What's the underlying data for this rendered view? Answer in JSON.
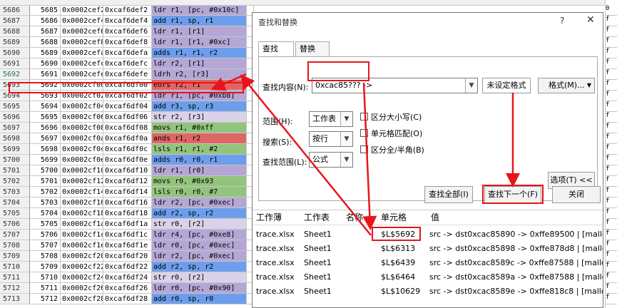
{
  "sheet_rows": [
    {
      "rn": "5686",
      "a": "5685",
      "b": "0x0002cef2",
      "c": "0xcaf6def2",
      "d": "ldr r1, [pc, #0x10c]",
      "color": "purple"
    },
    {
      "rn": "5687",
      "a": "5686",
      "b": "0x0002cef4",
      "c": "0xcaf6def4",
      "d": "add r1, sp, r1",
      "color": "blue"
    },
    {
      "rn": "5688",
      "a": "5687",
      "b": "0x0002cef6",
      "c": "0xcaf6def6",
      "d": "ldr r1, [r1]",
      "color": "purple"
    },
    {
      "rn": "5689",
      "a": "5688",
      "b": "0x0002cef8",
      "c": "0xcaf6def8",
      "d": "ldr r1, [r1, #0xc]",
      "color": "purple"
    },
    {
      "rn": "5690",
      "a": "5689",
      "b": "0x0002cefa",
      "c": "0xcaf6defa",
      "d": "adds r1, r1, r2",
      "color": "blue"
    },
    {
      "rn": "5691",
      "a": "5690",
      "b": "0x0002cefc",
      "c": "0xcaf6defc",
      "d": "ldr r2, [r1]",
      "color": "purple"
    },
    {
      "rn": "5692",
      "a": "5691",
      "b": "0x0002cefe",
      "c": "0xcaf6defe",
      "d": "ldrh r2, [r3]",
      "color": "purple",
      "sel": true
    },
    {
      "rn": "5693",
      "a": "5692",
      "b": "0x0002cf00",
      "c": "0xcaf6df00",
      "d": "eors r2, r1",
      "color": "red"
    },
    {
      "rn": "5694",
      "a": "5693",
      "b": "0x0002cf02",
      "c": "0xcaf6df02",
      "d": "ldr r1, [pc, #0xb8]",
      "color": "purple"
    },
    {
      "rn": "5695",
      "a": "5694",
      "b": "0x0002cf04",
      "c": "0xcaf6df04",
      "d": "add r3, sp, r3",
      "color": "blue"
    },
    {
      "rn": "5696",
      "a": "5695",
      "b": "0x0002cf06",
      "c": "0xcaf6df06",
      "d": "str r2, [r3]",
      "color": "lpurple"
    },
    {
      "rn": "5697",
      "a": "5696",
      "b": "0x0002cf08",
      "c": "0xcaf6df08",
      "d": "movs r1, #0xff",
      "color": "green"
    },
    {
      "rn": "5698",
      "a": "5697",
      "b": "0x0002cf0a",
      "c": "0xcaf6df0a",
      "d": "ands r1, r2",
      "color": "red"
    },
    {
      "rn": "5699",
      "a": "5698",
      "b": "0x0002cf0c",
      "c": "0xcaf6df0c",
      "d": "lsls r1, r1, #2",
      "color": "green"
    },
    {
      "rn": "5700",
      "a": "5699",
      "b": "0x0002cf0e",
      "c": "0xcaf6df0e",
      "d": "adds r0, r0, r1",
      "color": "blue"
    },
    {
      "rn": "5701",
      "a": "5700",
      "b": "0x0002cf10",
      "c": "0xcaf6df10",
      "d": "ldr r1, [r0]",
      "color": "purple"
    },
    {
      "rn": "5702",
      "a": "5701",
      "b": "0x0002cf12",
      "c": "0xcaf6df12",
      "d": "movs r0, #0x93",
      "color": "green"
    },
    {
      "rn": "5703",
      "a": "5702",
      "b": "0x0002cf14",
      "c": "0xcaf6df14",
      "d": "lsls r0, r0, #7",
      "color": "green"
    },
    {
      "rn": "5704",
      "a": "5703",
      "b": "0x0002cf16",
      "c": "0xcaf6df16",
      "d": "ldr r2, [pc, #0xec]",
      "color": "purple"
    },
    {
      "rn": "5705",
      "a": "5704",
      "b": "0x0002cf18",
      "c": "0xcaf6df18",
      "d": "add r2, sp, r2",
      "color": "blue"
    },
    {
      "rn": "5706",
      "a": "5705",
      "b": "0x0002cf1a",
      "c": "0xcaf6df1a",
      "d": "str r0, [r2]",
      "color": "lpurple"
    },
    {
      "rn": "5707",
      "a": "5706",
      "b": "0x0002cf1c",
      "c": "0xcaf6df1c",
      "d": "ldr r4, [pc, #0xe8]",
      "color": "purple"
    },
    {
      "rn": "5708",
      "a": "5707",
      "b": "0x0002cf1e",
      "c": "0xcaf6df1e",
      "d": "ldr r0, [pc, #0xec]",
      "color": "purple"
    },
    {
      "rn": "5709",
      "a": "5708",
      "b": "0x0002cf20",
      "c": "0xcaf6df20",
      "d": "ldr r2, [pc, #0xec]",
      "color": "purple"
    },
    {
      "rn": "5710",
      "a": "5709",
      "b": "0x0002cf22",
      "c": "0xcaf6df22",
      "d": "add r2, sp, r2",
      "color": "blue"
    },
    {
      "rn": "5711",
      "a": "5710",
      "b": "0x0002cf24",
      "c": "0xcaf6df24",
      "d": "str r0, [r2]",
      "color": "lpurple"
    },
    {
      "rn": "5712",
      "a": "5711",
      "b": "0x0002cf26",
      "c": "0xcaf6df26",
      "d": "ldr r0, [pc, #0x90]",
      "color": "purple"
    },
    {
      "rn": "5713",
      "a": "5712",
      "b": "0x0002cf28",
      "c": "0xcaf6df28",
      "d": "add r0, sp, r0",
      "color": "blue"
    }
  ],
  "dialog": {
    "title": "查找和替换",
    "help": "?",
    "close": "✕",
    "tabs": [
      {
        "label": "查找(D)",
        "active": true
      },
      {
        "label": "替换(P)",
        "active": false
      }
    ],
    "find_label": "查找内容(N):",
    "find_value": "0xcac85??? ->",
    "format_status": "未设定格式",
    "format_button": "格式(M)...",
    "scope_label": "范围(H):",
    "scope_value": "工作表",
    "search_label": "搜索(S):",
    "search_value": "按行",
    "lookin_label": "查找范围(L):",
    "lookin_value": "公式",
    "match_case": "区分大小写(C)",
    "match_cell": "单元格匹配(O)",
    "match_width": "区分全/半角(B)",
    "options_button": "选项(T) <<",
    "find_all": "查找全部(I)",
    "find_next": "查找下一个(F)",
    "close_button": "关闭"
  },
  "results": {
    "headers": [
      "工作薄",
      "工作表",
      "名称",
      "单元格",
      "值"
    ],
    "rows": [
      {
        "book": "trace.xlsx",
        "sheet": "Sheet1",
        "name": "",
        "cell": "$L$5692",
        "value": "src -> dst0xcac85890 -> 0xffe89500  |  [mallo"
      },
      {
        "book": "trace.xlsx",
        "sheet": "Sheet1",
        "name": "",
        "cell": "$L$6313",
        "value": "src -> dst0xcac85898 -> 0xffe878d8  |  [mallo"
      },
      {
        "book": "trace.xlsx",
        "sheet": "Sheet1",
        "name": "",
        "cell": "$L$6439",
        "value": "src -> dst0xcac8589c -> 0xffe87588  |  [mallo"
      },
      {
        "book": "trace.xlsx",
        "sheet": "Sheet1",
        "name": "",
        "cell": "$L$6464",
        "value": "src -> dst0xcac8589a -> 0xffe87588  |  [mallo"
      },
      {
        "book": "trace.xlsx",
        "sheet": "Sheet1",
        "name": "",
        "cell": "$L$10629",
        "value": "src -> dst0xcac8589e -> 0xffe818c8  |  [mallo"
      }
    ]
  },
  "right_cells": [
    "0",
    "f",
    "f",
    "f",
    "f",
    "f",
    "f",
    "f",
    "f",
    "f",
    "f",
    "f",
    "f",
    "f",
    "f",
    "f",
    "f",
    "f",
    "f",
    "f",
    "f",
    "f",
    "f",
    "f",
    "f",
    "f",
    "f",
    "f"
  ],
  "colors": {
    "purple": "#b4a7d6",
    "blue": "#6d9eeb",
    "green": "#93c47d",
    "red": "#e06666",
    "lpurple": "#d9d2e9",
    "highlight": "#e8141a"
  }
}
